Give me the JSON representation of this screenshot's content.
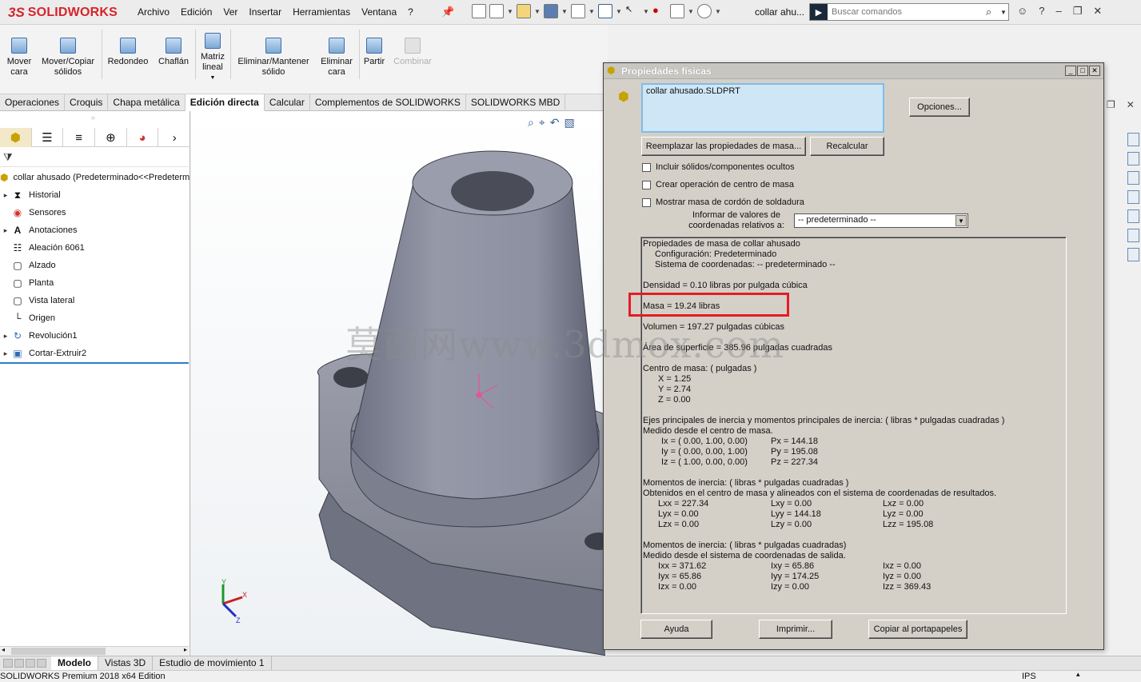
{
  "app": {
    "logo_prefix": "3S",
    "logo_text": "SOLIDWORKS",
    "doc_title": "collar ahu...",
    "status": "SOLIDWORKS Premium 2018 x64 Edition",
    "units": "IPS"
  },
  "menu": [
    "Archivo",
    "Edición",
    "Ver",
    "Insertar",
    "Herramientas",
    "Ventana",
    "?"
  ],
  "search": {
    "placeholder": "Buscar comandos"
  },
  "commands": [
    {
      "label_1": "Mover",
      "label_2": "cara",
      "enabled": true
    },
    {
      "label_1": "Mover/Copiar",
      "label_2": "sólidos",
      "enabled": true
    },
    {
      "label_1": "Redondeo",
      "label_2": "",
      "enabled": true
    },
    {
      "label_1": "Chaflán",
      "label_2": "",
      "enabled": true
    },
    {
      "label_1": "Matriz",
      "label_2": "lineal",
      "enabled": true
    },
    {
      "label_1": "Eliminar/Mantener",
      "label_2": "sólido",
      "enabled": true
    },
    {
      "label_1": "Eliminar",
      "label_2": "cara",
      "enabled": true
    },
    {
      "label_1": "Partir",
      "label_2": "",
      "enabled": true
    },
    {
      "label_1": "Combinar",
      "label_2": "",
      "enabled": false
    }
  ],
  "tabs": [
    "Operaciones",
    "Croquis",
    "Chapa metálica",
    "Edición directa",
    "Calcular",
    "Complementos de SOLIDWORKS",
    "SOLIDWORKS MBD"
  ],
  "active_tab": "Edición directa",
  "tree": {
    "root": "collar ahusado  (Predeterminado<<Predeterminado>)",
    "items": [
      "Historial",
      "Sensores",
      "Anotaciones",
      "Aleación 6061",
      "Alzado",
      "Planta",
      "Vista lateral",
      "Origen",
      "Revolución1",
      "Cortar-Extruir2"
    ]
  },
  "bottom_tabs": [
    "Modelo",
    "Vistas 3D",
    "Estudio de movimiento 1"
  ],
  "watermark": "莫西网www.3dmox.com",
  "triad": {
    "x": "X",
    "y": "Y",
    "z": "Z"
  },
  "dialog": {
    "title": "Propiedades físicas",
    "selection": "collar ahusado.SLDPRT",
    "btn_options": "Opciones...",
    "btn_override": "Reemplazar las propiedades de masa...",
    "btn_recalc": "Recalcular",
    "chk_hidden": "Incluir sólidos/componentes ocultos",
    "chk_com": "Crear operación de centro de masa",
    "chk_weld": "Mostrar masa de cordón de soldadura",
    "coord_label": "Informar de valores de coordenadas relativos a:",
    "coord_value": "-- predeterminado --",
    "btn_help": "Ayuda",
    "btn_print": "Imprimir...",
    "btn_copy": "Copiar al portapapeles",
    "results": {
      "header": "Propiedades de masa de collar ahusado",
      "config": "Configuración:  Predeterminado",
      "coordsys": "Sistema de coordenadas:  -- predeterminado --",
      "density": "Densidad = 0.10 libras por pulgada cúbica",
      "mass": "Masa = 19.24 libras",
      "volume": "Volumen = 197.27 pulgadas cúbicas",
      "area": "Área de superficie = 385.96 pulgadas cuadradas",
      "com_title": "Centro de masa: ( pulgadas )",
      "com": [
        "X = 1.25",
        "Y = 2.74",
        "Z = 0.00"
      ],
      "axes_title": "Ejes principales de inercia y momentos principales de inercia: ( libras * pulgadas cuadradas )",
      "axes_sub": "Medido desde el centro de masa.",
      "axes": [
        {
          "axis": "Ix = ( 0.00,  1.00,  0.00)",
          "moment": "Px = 144.18"
        },
        {
          "axis": "Iy = ( 0.00,  0.00,  1.00)",
          "moment": "Py = 195.08"
        },
        {
          "axis": "Iz = ( 1.00,  0.00,  0.00)",
          "moment": "Pz = 227.34"
        }
      ],
      "moi1_title": "Momentos de inercia: ( libras * pulgadas cuadradas )",
      "moi1_sub": "Obtenidos en el centro de masa y alineados con el sistema de coordenadas de resultados.",
      "moi1": [
        [
          "Lxx = 227.34",
          "Lxy = 0.00",
          "Lxz = 0.00"
        ],
        [
          "Lyx = 0.00",
          "Lyy = 144.18",
          "Lyz = 0.00"
        ],
        [
          "Lzx = 0.00",
          "Lzy = 0.00",
          "Lzz = 195.08"
        ]
      ],
      "moi2_title": "Momentos de inercia: ( libras * pulgadas cuadradas)",
      "moi2_sub": "Medido desde el sistema de coordenadas de salida.",
      "moi2": [
        [
          "Ixx = 371.62",
          "Ixy = 65.86",
          "Ixz = 0.00"
        ],
        [
          "Iyx = 65.86",
          "Iyy = 174.25",
          "Iyz = 0.00"
        ],
        [
          "Izx = 0.00",
          "Izy = 0.00",
          "Izz = 369.43"
        ]
      ]
    }
  },
  "colors": {
    "brand": "#d8232a",
    "highlight": "#e51c23",
    "selection_bg": "#cfe6f6"
  }
}
